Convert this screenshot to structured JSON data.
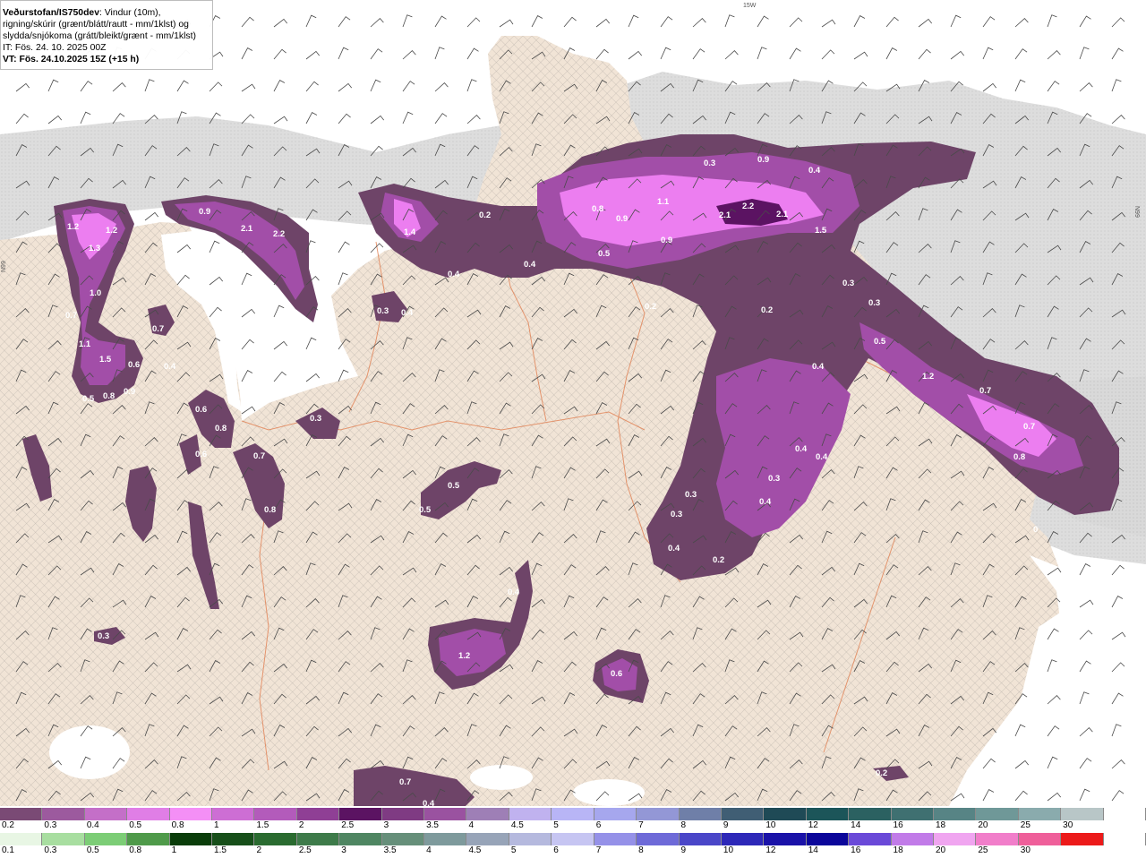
{
  "header": {
    "source": "Veðurstofan/IS750dev",
    "description": ": Vindur (10m),",
    "line2": "rigning/skúrir (grænt/blátt/rautt - mm/1klst) og",
    "line3": "slydda/snjókoma (grátt/bleikt/grænt - mm/1klst)",
    "init_time": "IT: Fös. 24. 10. 2025 00Z",
    "valid_time": "VT: Fös. 24.10.2025 15Z (+15 h)"
  },
  "axis_labels": {
    "top": "15W",
    "left": "N99",
    "right": "N99"
  },
  "colors": {
    "ocean": "#ffffff",
    "sea_dotted": "#d4d4d4",
    "land": "#f1e4d6",
    "roads": "#e07a4a",
    "precip_light": "#7a4a75",
    "precip_mid": "#a54bb0",
    "precip_heavy": "#f07ef0",
    "precip_peak": "#5b1362"
  },
  "map_values": [
    {
      "v": "1.2"
    },
    {
      "v": "1.2"
    },
    {
      "v": "1.3"
    },
    {
      "v": "1.0"
    },
    {
      "v": "0.7"
    },
    {
      "v": "1.1"
    },
    {
      "v": "1.5"
    },
    {
      "v": "0.6"
    },
    {
      "v": "0.4"
    },
    {
      "v": "0.5"
    },
    {
      "v": "0.8"
    },
    {
      "v": "0.9"
    },
    {
      "v": "0.7"
    },
    {
      "v": "0.6"
    },
    {
      "v": "0.3"
    },
    {
      "v": "0.9"
    },
    {
      "v": "2.1"
    },
    {
      "v": "2.2"
    },
    {
      "v": "0.4"
    },
    {
      "v": "1.4"
    },
    {
      "v": "0.2"
    },
    {
      "v": "0.4"
    },
    {
      "v": "0.4"
    },
    {
      "v": "0.3"
    },
    {
      "v": "0.4"
    },
    {
      "v": "0.8"
    },
    {
      "v": "0.9"
    },
    {
      "v": "1.1"
    },
    {
      "v": "0.5"
    },
    {
      "v": "0.9"
    },
    {
      "v": "2.1"
    },
    {
      "v": "2.2"
    },
    {
      "v": "2.1"
    },
    {
      "v": "1.5"
    },
    {
      "v": "0.4"
    },
    {
      "v": "0.3"
    },
    {
      "v": "0.9"
    },
    {
      "v": "0.2"
    },
    {
      "v": "0.2"
    },
    {
      "v": "0.3"
    },
    {
      "v": "0.3"
    },
    {
      "v": "0.5"
    },
    {
      "v": "0.4"
    },
    {
      "v": "1.2"
    },
    {
      "v": "0.7"
    },
    {
      "v": "0.7"
    },
    {
      "v": "0.8"
    },
    {
      "v": "0.4"
    },
    {
      "v": "0.4"
    },
    {
      "v": "0.3"
    },
    {
      "v": "0.4"
    },
    {
      "v": "0.3"
    },
    {
      "v": "0.3"
    },
    {
      "v": "0.4"
    },
    {
      "v": "0.2"
    },
    {
      "v": "0.3"
    },
    {
      "v": "0.5"
    },
    {
      "v": "0.5"
    },
    {
      "v": "0.4"
    },
    {
      "v": "1.2"
    },
    {
      "v": "0.6"
    },
    {
      "v": "0.3"
    },
    {
      "v": "0.7"
    },
    {
      "v": "0.4"
    },
    {
      "v": "0.2"
    },
    {
      "v": "0"
    },
    {
      "v": "0.8"
    },
    {
      "v": "0.6"
    },
    {
      "v": "0.7"
    },
    {
      "v": "0.8"
    }
  ],
  "legend_snow": {
    "colors": [
      "#7a4a75",
      "#9c5a9e",
      "#c46fc8",
      "#e07ee6",
      "#f48ff6",
      "#cd6ed4",
      "#b35bbb",
      "#8f3f95",
      "#5b1362",
      "#7f3b83",
      "#9a52a0",
      "#9e7fb6",
      "#c0b2ef",
      "#b8b5f6",
      "#a6a7ee",
      "#9397d6",
      "#6f7fa8",
      "#405e74",
      "#1f4a56",
      "#1c5559",
      "#2b6161",
      "#3f7071",
      "#578485",
      "#6f9898",
      "#8aabad",
      "#b8c6c7",
      "#ffffff"
    ],
    "labels": [
      "0.2",
      "0.3",
      "0.4",
      "0.5",
      "0.8",
      "1",
      "1.5",
      "2",
      "2.5",
      "3",
      "3.5",
      "4",
      "4.5",
      "5",
      "6",
      "7",
      "8",
      "9",
      "10",
      "12",
      "14",
      "16",
      "18",
      "20",
      "25",
      "30"
    ]
  },
  "legend_rain": {
    "colors": [
      "#e8f6e4",
      "#a8dea0",
      "#7ccd76",
      "#4f9a4a",
      "#0a3d0a",
      "#174f1a",
      "#2a6b30",
      "#3e7b4a",
      "#4f8662",
      "#668f7a",
      "#7e9a9c",
      "#97a4b8",
      "#b5b9de",
      "#c6c5f2",
      "#9591e8",
      "#6e6ad8",
      "#4a46c8",
      "#2d28b8",
      "#1a12a8",
      "#0b069a",
      "#6a49d8",
      "#c17be8",
      "#f0a5f0",
      "#f17eca",
      "#ef5f9a",
      "#ec1a1a",
      "#ffffff"
    ],
    "labels": [
      "0.1",
      "0.3",
      "0.5",
      "0.8",
      "1",
      "1.5",
      "2",
      "2.5",
      "3",
      "3.5",
      "4",
      "4.5",
      "5",
      "6",
      "7",
      "8",
      "9",
      "10",
      "12",
      "14",
      "16",
      "18",
      "20",
      "25",
      "30"
    ]
  }
}
